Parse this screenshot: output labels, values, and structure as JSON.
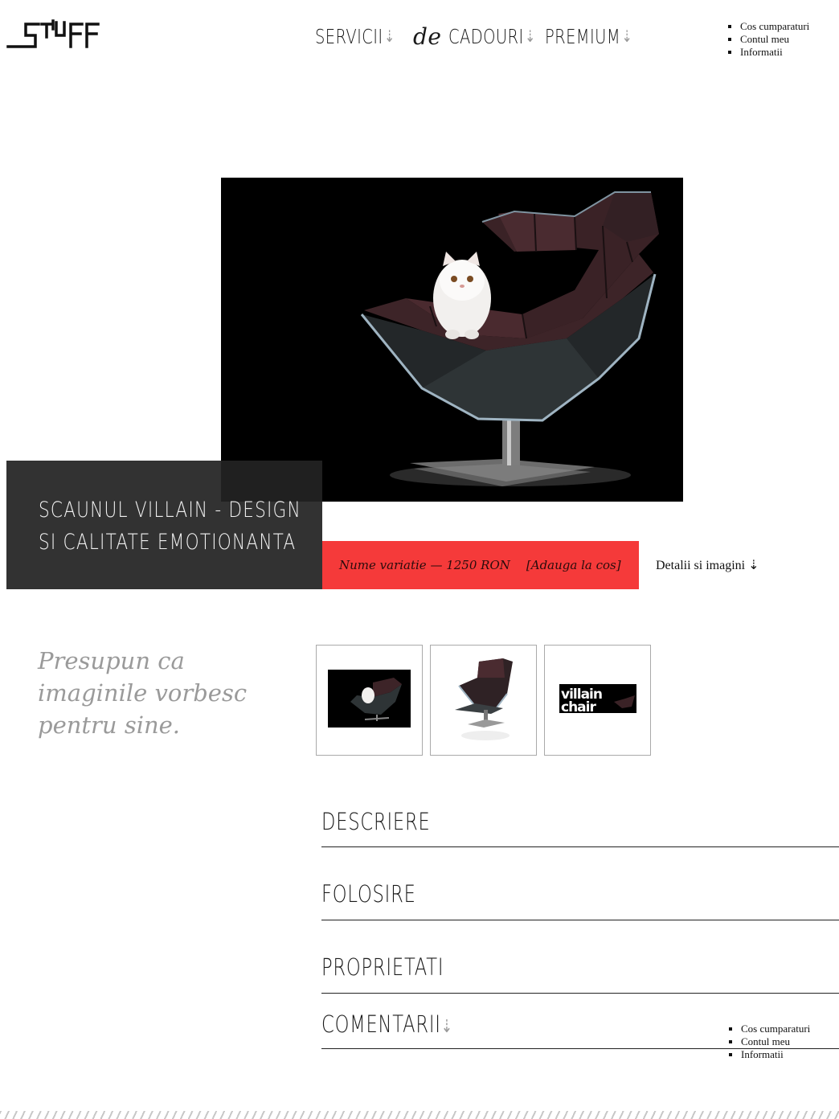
{
  "brand": {
    "logo_text": "Stuff"
  },
  "nav": {
    "servicii": "SERVICII",
    "de": "de",
    "cadouri": "CADOURI",
    "premium": "PREMIUM",
    "arrow": "⇣"
  },
  "util_menu": {
    "items": [
      "Cos cumparaturi",
      "Contul meu",
      "Informatii"
    ]
  },
  "product": {
    "title_line1": "SCAUNUL VILLAIN - DESIGN",
    "title_line2": "SI CALITATE EMOTIONANTA",
    "variation_price": "Nume variatie — 1250 RON",
    "add_to_cart": "[Adauga la cos]",
    "details_link": "Detalii si imagini ⇣",
    "quote": "Presupun ca imaginile vorbesc pentru sine.",
    "thumb_brand_text": "villain chair"
  },
  "sections": {
    "descriere": "DESCRIERE",
    "folosire": "FOLOSIRE",
    "proprietati": "PROPRIETATI",
    "comentarii": "COMENTARII",
    "comentarii_arrow": "⇣"
  },
  "colors": {
    "accent_red": "#f53a3a",
    "title_box": "#222222",
    "quote_gray": "#9a9a9a"
  },
  "icons": [
    "down-arrow-icon",
    "logo-mark"
  ]
}
